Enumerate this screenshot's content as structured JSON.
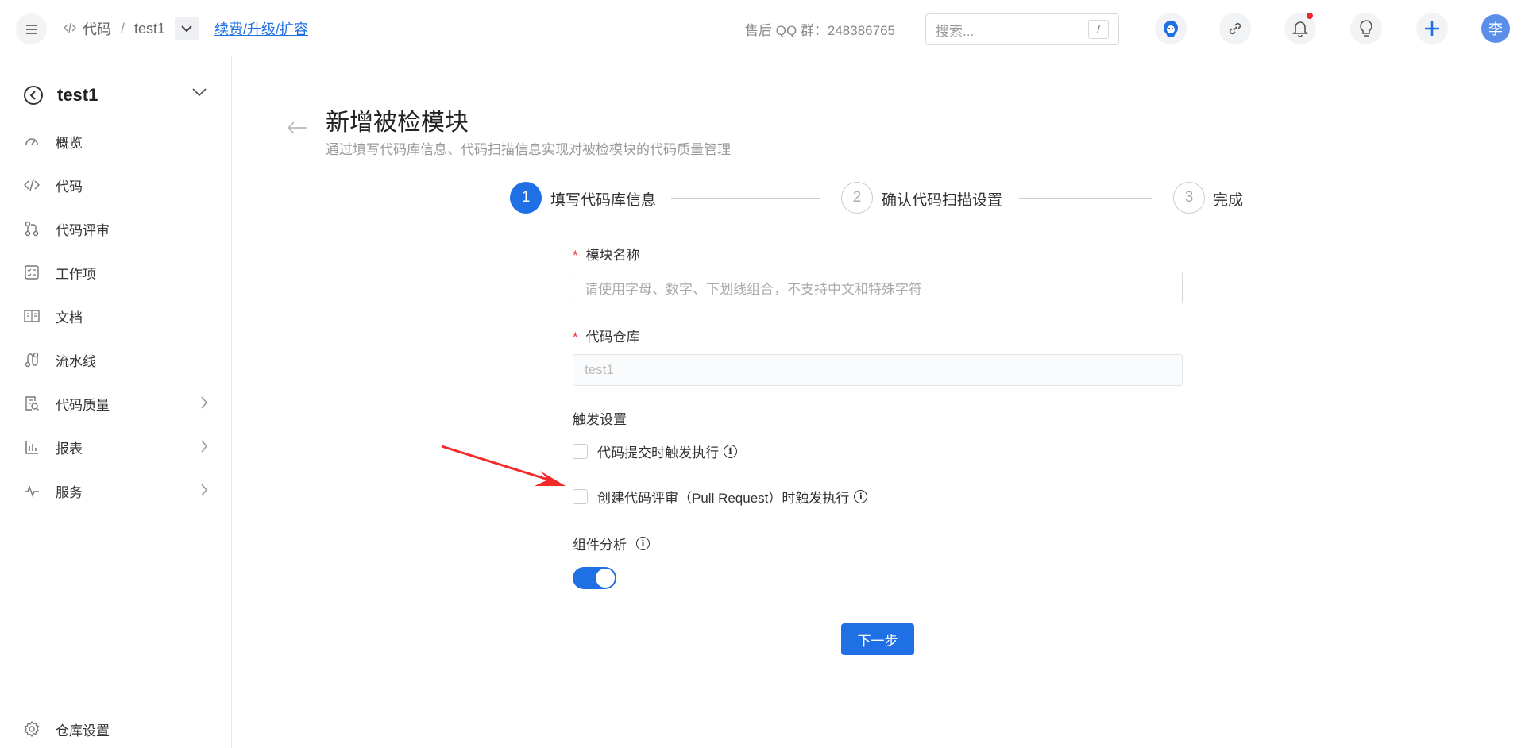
{
  "header": {
    "breadcrumb": {
      "root": "代码",
      "separator": "/",
      "repo": "test1"
    },
    "renew_link": "续费/升级/扩容",
    "qq_group": "售后 QQ 群：248386765",
    "search": {
      "placeholder": "搜索...",
      "shortcut": "/"
    },
    "avatar_text": "李",
    "icons": [
      "menu-icon",
      "code-icon",
      "chevron-down-icon",
      "mascot-icon",
      "link-icon",
      "bell-icon",
      "lightbulb-icon",
      "plus-icon"
    ]
  },
  "sidebar": {
    "project_name": "test1",
    "items": [
      {
        "label": "概览",
        "icon": "gauge-icon",
        "has_children": false
      },
      {
        "label": "代码",
        "icon": "code-icon",
        "has_children": false
      },
      {
        "label": "代码评审",
        "icon": "merge-request-icon",
        "has_children": false
      },
      {
        "label": "工作项",
        "icon": "checklist-icon",
        "has_children": false
      },
      {
        "label": "文档",
        "icon": "document-icon",
        "has_children": false
      },
      {
        "label": "流水线",
        "icon": "pipeline-icon",
        "has_children": false
      },
      {
        "label": "代码质量",
        "icon": "quality-scan-icon",
        "has_children": true
      },
      {
        "label": "报表",
        "icon": "bar-chart-icon",
        "has_children": true
      },
      {
        "label": "服务",
        "icon": "pulse-icon",
        "has_children": true
      }
    ],
    "settings_label": "仓库设置"
  },
  "main": {
    "title": "新增被检模块",
    "subtitle": "通过填写代码库信息、代码扫描信息实现对被检模块的代码质量管理",
    "steps": [
      {
        "number": "1",
        "label": "填写代码库信息",
        "active": true
      },
      {
        "number": "2",
        "label": "确认代码扫描设置",
        "active": false
      },
      {
        "number": "3",
        "label": "完成",
        "active": false
      }
    ],
    "form": {
      "required_mark": "*",
      "module_name": {
        "label": "模块名称",
        "placeholder": "请使用字母、数字、下划线组合，不支持中文和特殊字符"
      },
      "repo": {
        "label": "代码仓库",
        "value": "test1"
      },
      "trigger_section": "触发设置",
      "trigger_commit": {
        "label": "代码提交时触发执行",
        "checked": false
      },
      "trigger_pr": {
        "label": "创建代码评审（Pull Request）时触发执行",
        "checked": false
      },
      "component_analysis": {
        "label": "组件分析",
        "enabled": true
      },
      "info_glyph": "i",
      "next_button": "下一步"
    }
  },
  "colors": {
    "primary": "#1f6fe5",
    "required": "#f5222d",
    "annotation_arrow": "#f22a2a"
  }
}
